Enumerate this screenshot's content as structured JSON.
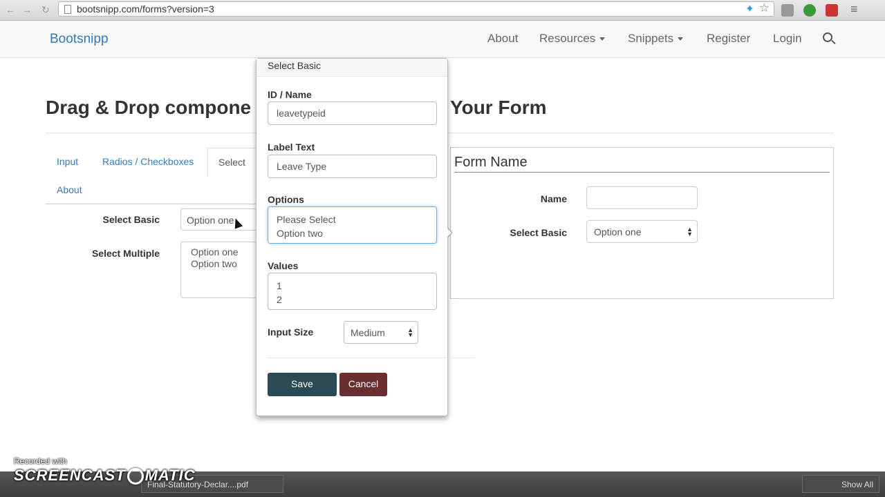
{
  "browser": {
    "url": "bootsnipp.com/forms?version=3",
    "back_glyph": "←",
    "forward_glyph": "→",
    "reload_glyph": "↻",
    "star_glyph": "☆",
    "menu_glyph": "≡",
    "icons": [
      "doc-icon",
      "twitter-icon",
      "star-icon",
      "ext-icon",
      "menu-icon"
    ]
  },
  "navbar": {
    "brand": "Bootsnipp",
    "items": [
      {
        "label": "About"
      },
      {
        "label": "Resources"
      },
      {
        "label": "Snippets"
      },
      {
        "label": "Register"
      },
      {
        "label": "Login"
      }
    ]
  },
  "heading": {
    "left": "Drag & Drop compone",
    "right": "Your Form"
  },
  "tabs": [
    {
      "label": "Input"
    },
    {
      "label": "Radios / Checkboxes"
    },
    {
      "label": "Select"
    },
    {
      "label": "About"
    }
  ],
  "components": {
    "select_basic_label": "Select Basic",
    "select_basic_value": "Option one",
    "select_multiple_label": "Select Multiple",
    "select_multiple_options": [
      "Option one",
      "Option two"
    ]
  },
  "popover": {
    "title": "Select Basic",
    "id_label": "ID / Name",
    "id_value": "leavetypeid",
    "label_text_label": "Label Text",
    "label_text_value": "Leave Type",
    "options_label": "Options",
    "options_lines": [
      "Please Select",
      "Option two"
    ],
    "values_label": "Values",
    "values_lines": [
      "1",
      "2"
    ],
    "input_size_label": "Input Size",
    "input_size_value": "Medium",
    "save_label": "Save",
    "cancel_label": "Cancel"
  },
  "form": {
    "legend": "Form Name",
    "name_label": "Name",
    "select_label": "Select Basic",
    "select_value": "Option one"
  },
  "taskbar": {
    "watermark_small": "Recorded with",
    "watermark_big_a": "SCREENCAST",
    "watermark_big_b": "MATIC",
    "download_file": "Final-Statutory-Declar....pdf",
    "show_all": "Show All"
  },
  "colors": {
    "brand": "#337ab7",
    "save": "#2a4a55",
    "cancel": "#6b2e2e",
    "focus": "#66afe9"
  }
}
